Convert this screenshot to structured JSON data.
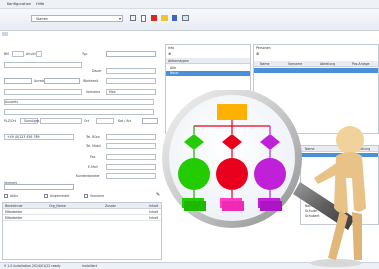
{
  "menu": {
    "items": [
      "Konfiguration",
      "Hilfe"
    ]
  },
  "toolbar": {
    "combo_value": "Starten"
  },
  "form": {
    "label_bm": "BM",
    "label_bm_sub": "Ansicht",
    "label_typ": "Typ",
    "label_dauer": "Dauer",
    "label_wartezeit": "Wartezeit",
    "label_vorname": "Vorname",
    "vorname_value": "Max",
    "label_ort": "Ort",
    "label_tel_buero": "Tel. Büro",
    "label_tel_mobil": "Tel. Mobil",
    "label_fax": "Fax",
    "label_email": "E-Mail",
    "label_kundenber": "Kundenberater",
    "label_anrede": "Anrede",
    "label_ausweis": "Ausweis",
    "label_pl_ort": "PLZ/Ort",
    "label_vermerk": "Vermerk",
    "label_kat": "Kat / Art",
    "row_sz": "Sonstiges",
    "phone_value": "+49 (0)123 456 789"
  },
  "checks": {
    "aktiv": "Aktiv",
    "angemeldet": "Angemeldet",
    "vorname": "Vorname"
  },
  "bottom_table": {
    "headers": [
      "Bezeichner",
      "Org_Name",
      "Zusatz",
      "Inhalt"
    ],
    "rows": [
      [
        "Mitarbeiter",
        "",
        "",
        "Inhalt"
      ],
      [
        "Mitarbeiter",
        "",
        "",
        "Inhalt"
      ]
    ]
  },
  "mid_panel": {
    "header": "Info",
    "subheader": "Aktionstypen",
    "rows": [
      "Alle",
      "Neue"
    ]
  },
  "right_panel": {
    "header": "Personen",
    "columns": [
      "Name",
      "Vorname",
      "Abteilung",
      "Pos.Anlage"
    ],
    "rows2_headers": [
      "Name",
      "Abteilung"
    ],
    "rows2": [
      "Name",
      "Schulte",
      "Schubert"
    ]
  },
  "status": {
    "left": "V 1.0 Installation 2014/01/22 ready",
    "right": "Installiert"
  },
  "magnifier": {
    "colors": {
      "top_box": "#ffb000",
      "green": "#22cc00",
      "red": "#e8001c",
      "purple": "#c020d8",
      "pink": "#ff3ec4",
      "ring": "#d9d9d9"
    }
  }
}
